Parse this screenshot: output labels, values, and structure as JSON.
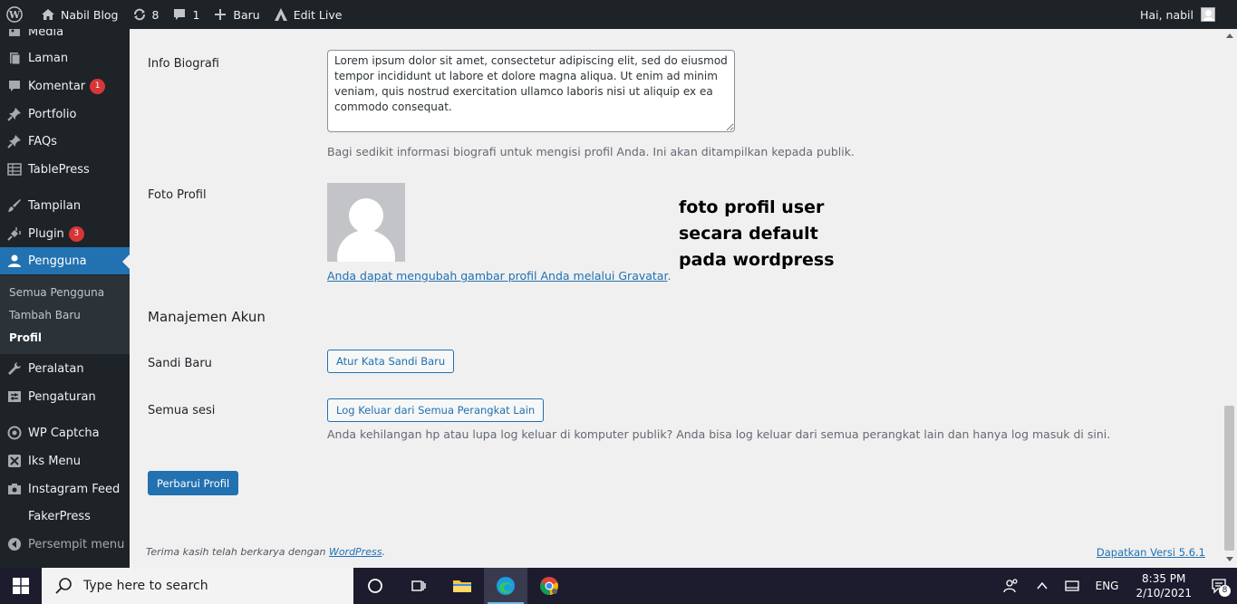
{
  "adminbar": {
    "site_name": "Nabil Blog",
    "updates_count": "8",
    "comments_count": "1",
    "new_label": "Baru",
    "edit_live_label": "Edit Live",
    "greeting": "Hai, nabil"
  },
  "sidebar": {
    "items": [
      {
        "label": "Media",
        "icon": "media-icon"
      },
      {
        "label": "Laman",
        "icon": "page-icon"
      },
      {
        "label": "Komentar",
        "icon": "comment-icon",
        "badge": "1"
      },
      {
        "label": "Portfolio",
        "icon": "pin-icon"
      },
      {
        "label": "FAQs",
        "icon": "pin-icon"
      },
      {
        "label": "TablePress",
        "icon": "table-icon"
      },
      {
        "label": "Tampilan",
        "icon": "brush-icon"
      },
      {
        "label": "Plugin",
        "icon": "plugin-icon",
        "badge": "3"
      },
      {
        "label": "Pengguna",
        "icon": "user-icon"
      },
      {
        "label": "Peralatan",
        "icon": "wrench-icon"
      },
      {
        "label": "Pengaturan",
        "icon": "settings-icon"
      },
      {
        "label": "WP Captcha",
        "icon": "shield-icon"
      },
      {
        "label": "Iks Menu",
        "icon": "menu-icon"
      },
      {
        "label": "Instagram Feed",
        "icon": "camera-icon"
      },
      {
        "label": "FakerPress",
        "icon": ""
      }
    ],
    "submenu": [
      "Semua Pengguna",
      "Tambah Baru",
      "Profil"
    ],
    "collapse_label": "Persempit menu"
  },
  "profile": {
    "bio_label": "Info Biografi",
    "bio_value": "Lorem ipsum dolor sit amet, consectetur adipiscing elit, sed do eiusmod tempor incididunt ut labore et dolore magna aliqua. Ut enim ad minim veniam, quis nostrud exercitation ullamco laboris nisi ut aliquip ex ea commodo consequat.",
    "bio_desc": "Bagi sedikit informasi biografi untuk mengisi profil Anda. Ini akan ditampilkan kepada publik.",
    "photo_label": "Foto Profil",
    "gravatar_link": "Anda dapat mengubah gambar profil Anda melalui Gravatar",
    "gravatar_suffix": ".",
    "annotation": "foto profil user\nsecara default\npada wordpress",
    "account_heading": "Manajemen Akun",
    "new_password_label": "Sandi Baru",
    "set_password_button": "Atur Kata Sandi Baru",
    "sessions_label": "Semua sesi",
    "logout_everywhere_button": "Log Keluar dari Semua Perangkat Lain",
    "sessions_desc": "Anda kehilangan hp atau lupa log keluar di komputer publik? Anda bisa log keluar dari semua perangkat lain dan hanya log masuk di sini.",
    "update_button": "Perbarui Profil"
  },
  "footer": {
    "thanks_prefix": "Terima kasih telah berkarya dengan ",
    "wordpress_link": "WordPress",
    "thanks_suffix": ".",
    "version_link": "Dapatkan Versi 5.6.1"
  },
  "taskbar": {
    "search_placeholder": "Type here to search",
    "language": "ENG",
    "time": "8:35 PM",
    "date": "2/10/2021",
    "notification_count": "8"
  },
  "colors": {
    "admin_dark": "#1d2327",
    "accent_blue": "#2271b1",
    "badge_red": "#d63638"
  }
}
